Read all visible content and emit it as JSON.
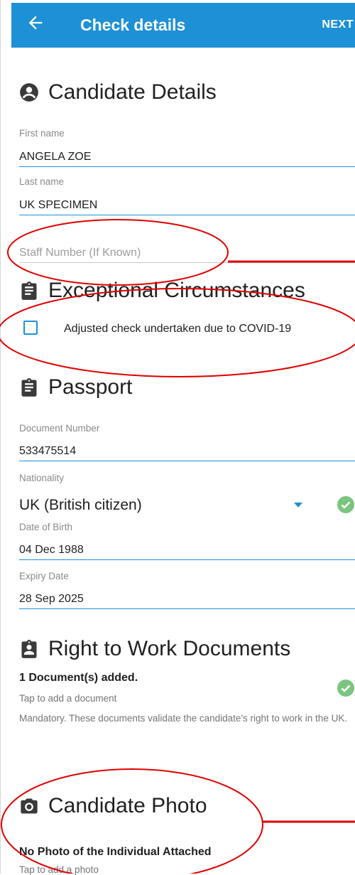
{
  "appbar": {
    "title": "Check details",
    "next": "NEXT"
  },
  "candidate": {
    "heading": "Candidate Details",
    "first_name_label": "First name",
    "first_name": "ANGELA ZOE",
    "last_name_label": "Last name",
    "last_name": "UK SPECIMEN",
    "staff_number_placeholder": "Staff Number (If Known)"
  },
  "exceptional": {
    "heading": "Exceptional Circumstances",
    "checkbox_label": "Adjusted check undertaken due to COVID-19",
    "checked": false
  },
  "passport": {
    "heading": "Passport",
    "doc_number_label": "Document Number",
    "doc_number": "533475514",
    "nationality_label": "Nationality",
    "nationality": "UK (British citizen)",
    "dob_label": "Date of Birth",
    "dob": "04 Dec 1988",
    "expiry_label": "Expiry Date",
    "expiry": "28 Sep 2025"
  },
  "rtw": {
    "heading": "Right to Work Documents",
    "count_text": "1 Document(s) added.",
    "tap_text": "Tap to add a document",
    "mandatory_text": "Mandatory. These documents validate the candidate's right to work in the UK."
  },
  "photo": {
    "heading": "Candidate Photo",
    "none_text": "No Photo of the Individual Attached",
    "tap_text": "Tap to add a photo"
  },
  "colors": {
    "primary": "#1e90d6",
    "success": "#7bc67e",
    "annotation": "#e00000"
  }
}
